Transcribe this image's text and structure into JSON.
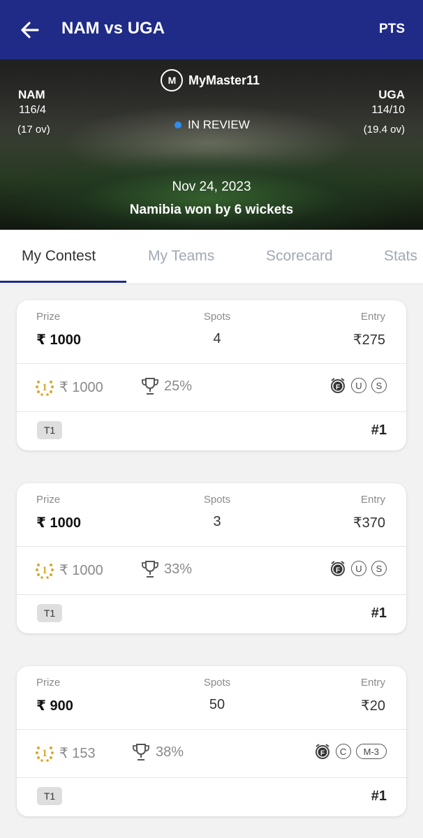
{
  "header": {
    "title": "NAM vs UGA",
    "right_label": "PTS"
  },
  "match": {
    "brand": "MyMaster11",
    "brand_mark": "M",
    "team_left": {
      "name": "NAM",
      "score": "116/4",
      "overs": "(17 ov)"
    },
    "team_right": {
      "name": "UGA",
      "score": "114/10",
      "overs": "(19.4 ov)"
    },
    "status": "IN REVIEW",
    "status_color": "#2f8cf0",
    "date": "Nov 24, 2023",
    "result": "Namibia won by 6 wickets"
  },
  "tabs": [
    {
      "label": "My Contest",
      "active": true
    },
    {
      "label": "My Teams",
      "active": false
    },
    {
      "label": "Scorecard",
      "active": false
    },
    {
      "label": "Stats",
      "active": false
    }
  ],
  "labels": {
    "prize": "Prize",
    "spots": "Spots",
    "entry": "Entry"
  },
  "contests": [
    {
      "prize": "₹ 1000",
      "spots": "4",
      "entry": "₹275",
      "first_prize": "₹ 1000",
      "win_pct": "25%",
      "badges": [
        "F-icon",
        "U",
        "S"
      ],
      "team": "T1",
      "rank": "#1"
    },
    {
      "prize": "₹ 1000",
      "spots": "3",
      "entry": "₹370",
      "first_prize": "₹ 1000",
      "win_pct": "33%",
      "badges": [
        "F-icon",
        "U",
        "S"
      ],
      "team": "T1",
      "rank": "#1"
    },
    {
      "prize": "₹ 900",
      "spots": "50",
      "entry": "₹20",
      "first_prize": "₹ 153",
      "win_pct": "38%",
      "badges": [
        "F-icon",
        "C",
        "M-3"
      ],
      "team": "T1",
      "rank": "#1"
    }
  ],
  "colors": {
    "primary": "#1f2b87",
    "gold": "#d8a82a"
  }
}
